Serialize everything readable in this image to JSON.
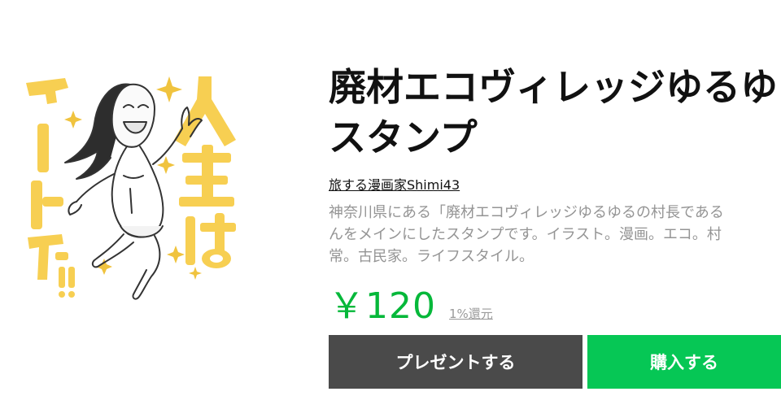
{
  "sticker": {
    "image_text": "人生はアートだ!!",
    "accent_color": "#f7cf52"
  },
  "product": {
    "title_line1": "廃材エコヴィレッジゆるゆ",
    "title_line2": "スタンプ",
    "author": "旅する漫画家Shimi43",
    "description_line1": "神奈川県にある「廃材エコヴィレッジゆるゆるの村長である",
    "description_line2": "んをメインにしたスタンプです。イラスト。漫画。エコ。村",
    "description_line3": "常。古民家。ライフスタイル。"
  },
  "pricing": {
    "price": "￥120",
    "reward": "1%還元",
    "price_color": "#06b83a"
  },
  "actions": {
    "gift_label": "プレゼントする",
    "buy_label": "購入する",
    "gift_color": "#4a4a4a",
    "buy_color": "#06c755"
  }
}
